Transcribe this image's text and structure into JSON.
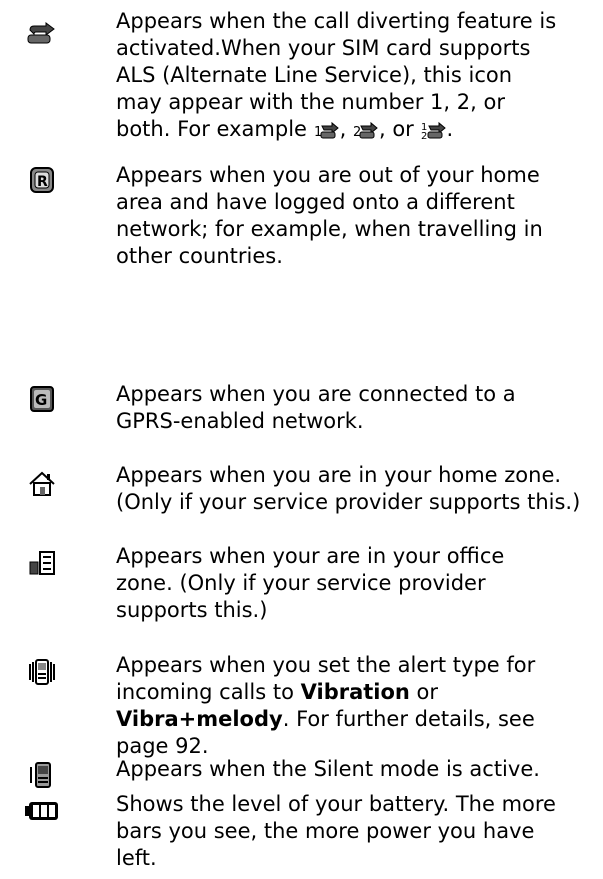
{
  "entries": [
    {
      "icon": "call-divert-icon",
      "lines": [
        "Appears when the call diverting feature is",
        "activated.When your SIM card supports",
        "ALS (Alternate Line Service), this icon",
        "may appear with the number 1, 2, or"
      ],
      "last_line_prefix": "both. For example ",
      "sep1": ", ",
      "sep2": ", or ",
      "last_line_suffix": "."
    },
    {
      "icon": "roaming-icon",
      "lines": [
        "Appears when you are out of your home",
        "area and have logged onto a different",
        "network; for example, when travelling in",
        "other countries."
      ]
    },
    {
      "icon": "gprs-icon",
      "lines": [
        "Appears when you are connected to a",
        "GPRS-enabled network."
      ]
    },
    {
      "icon": "home-zone-icon",
      "lines": [
        "Appears when you are in your home zone.",
        "(Only if your service provider supports this.)"
      ]
    },
    {
      "icon": "office-zone-icon",
      "lines": [
        "Appears when your are in your office",
        "zone. (Only if your service provider",
        "supports this.)"
      ]
    },
    {
      "icon": "vibration-icon",
      "l1": "Appears when you set the alert type for",
      "l2a": "incoming calls to ",
      "l2b": "Vibration",
      "l2c": " or",
      "l3a": "Vibra+melody",
      "l3b": ". For further details, see",
      "l4": "page 92."
    },
    {
      "icon": "silent-mode-icon",
      "lines": [
        "Appears when the Silent mode is active."
      ]
    },
    {
      "icon": "battery-icon",
      "lines": [
        "Shows the level of your battery. The more",
        "bars you see, the more power you have",
        "left."
      ]
    }
  ]
}
